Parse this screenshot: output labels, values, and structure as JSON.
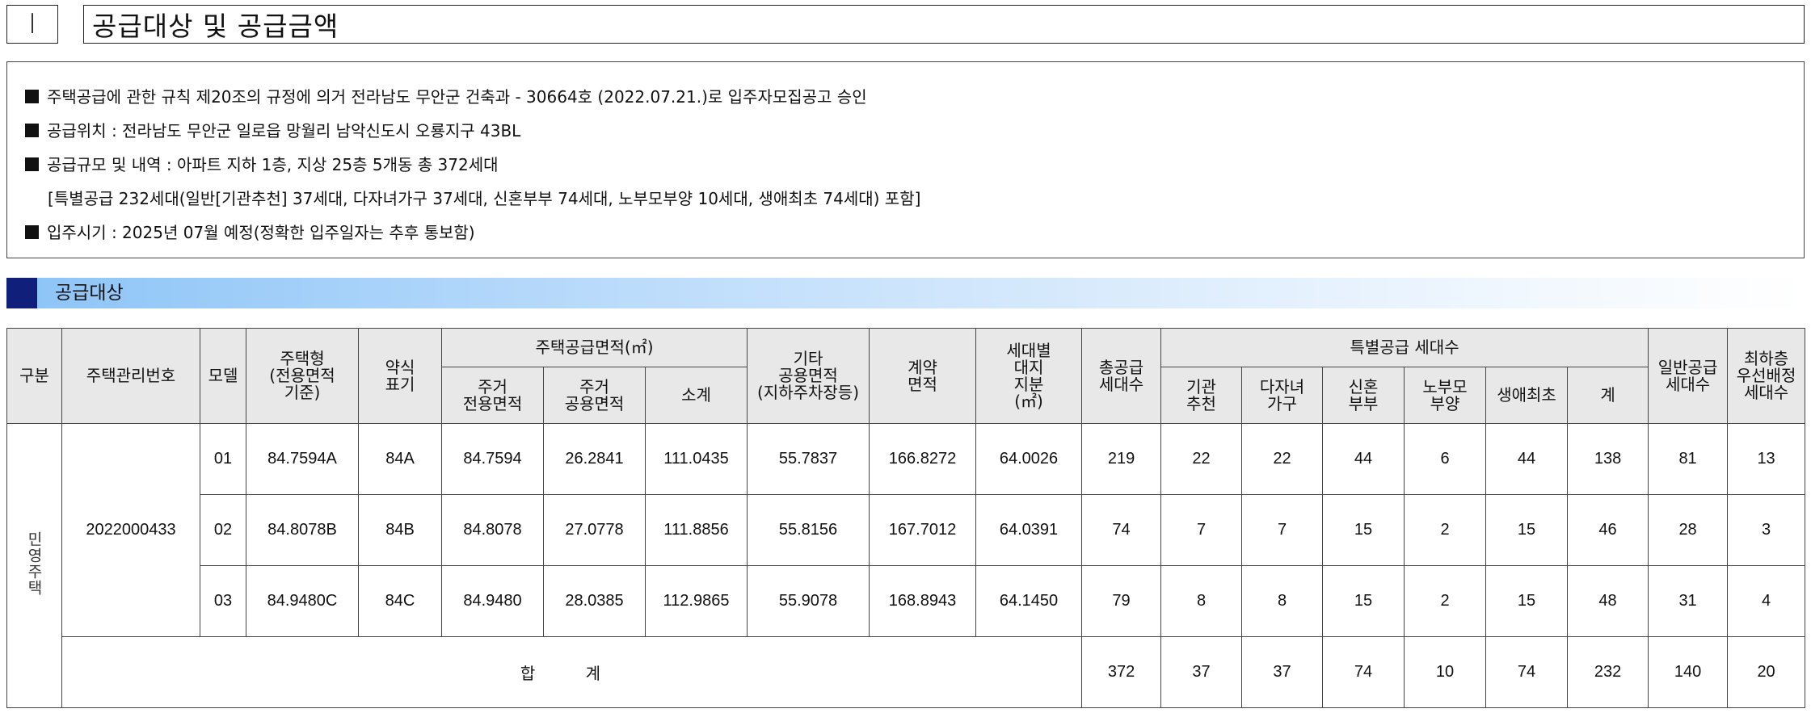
{
  "section": {
    "number": "Ⅰ",
    "title": "공급대상 및 공급금액"
  },
  "info": {
    "lines": [
      "주택공급에 관한 규칙 제20조의 규정에 의거 전라남도 무안군 건축과 - 30664호 (2022.07.21.)로 입주자모집공고 승인",
      "공급위치 : 전라남도 무안군 일로읍 망월리 남악신도시 오룡지구 43BL",
      "공급규모 및 내역 : 아파트 지하 1층, 지상 25층 5개동 총 372세대",
      "[특별공급 232세대(일반[기관추천] 37세대, 다자녀가구 37세대, 신혼부부 74세대, 노부모부양 10세대, 생애최초 74세대) 포함]",
      "입주시기 : 2025년 07월 예정(정확한 입주일자는 추후 통보함)"
    ]
  },
  "subsection": {
    "title": "공급대상"
  },
  "table": {
    "headers": {
      "gubun": "구분",
      "housing_no": "주택관리번호",
      "model": "모델",
      "type": "주택형\n(전용면적\n기준)",
      "abbr": "약식\n표기",
      "area_group": "주택공급면적(㎡)",
      "excl_area": "주거\n전용면적",
      "common_area": "주거\n공용면적",
      "subtotal": "소계",
      "other_area": "기타\n공용면적\n(지하주차장등)",
      "contract_area": "계약\n면적",
      "land_share": "세대별\n대지\n지분\n(㎡)",
      "total_supply": "총공급\n세대수",
      "special_group": "특별공급 세대수",
      "inst": "기관\n추천",
      "multi": "다자녀\n가구",
      "newlywed": "신혼\n부부",
      "elderly": "노부모\n부양",
      "first": "생애최초",
      "sp_total": "계",
      "general": "일반공급\n세대수",
      "lowest_floor": "최하층\n우선배정\n세대수"
    },
    "category": "민영주택",
    "housing_no": "2022000433",
    "rows": [
      {
        "model": "01",
        "type": "84.7594A",
        "abbr": "84A",
        "excl": "84.7594",
        "common": "26.2841",
        "sub": "111.0435",
        "other": "55.7837",
        "contract": "166.8272",
        "land": "64.0026",
        "total": "219",
        "inst": "22",
        "multi": "22",
        "newlywed": "44",
        "elderly": "6",
        "first": "44",
        "sp_total": "138",
        "general": "81",
        "lowest": "13"
      },
      {
        "model": "02",
        "type": "84.8078B",
        "abbr": "84B",
        "excl": "84.8078",
        "common": "27.0778",
        "sub": "111.8856",
        "other": "55.8156",
        "contract": "167.7012",
        "land": "64.0391",
        "total": "74",
        "inst": "7",
        "multi": "7",
        "newlywed": "15",
        "elderly": "2",
        "first": "15",
        "sp_total": "46",
        "general": "28",
        "lowest": "3"
      },
      {
        "model": "03",
        "type": "84.9480C",
        "abbr": "84C",
        "excl": "84.9480",
        "common": "28.0385",
        "sub": "112.9865",
        "other": "55.9078",
        "contract": "168.8943",
        "land": "64.1450",
        "total": "79",
        "inst": "8",
        "multi": "8",
        "newlywed": "15",
        "elderly": "2",
        "first": "15",
        "sp_total": "48",
        "general": "31",
        "lowest": "4"
      }
    ],
    "totals": {
      "label": "합 계",
      "total": "372",
      "inst": "37",
      "multi": "37",
      "newlywed": "74",
      "elderly": "10",
      "first": "74",
      "sp_total": "232",
      "general": "140",
      "lowest": "20"
    }
  }
}
